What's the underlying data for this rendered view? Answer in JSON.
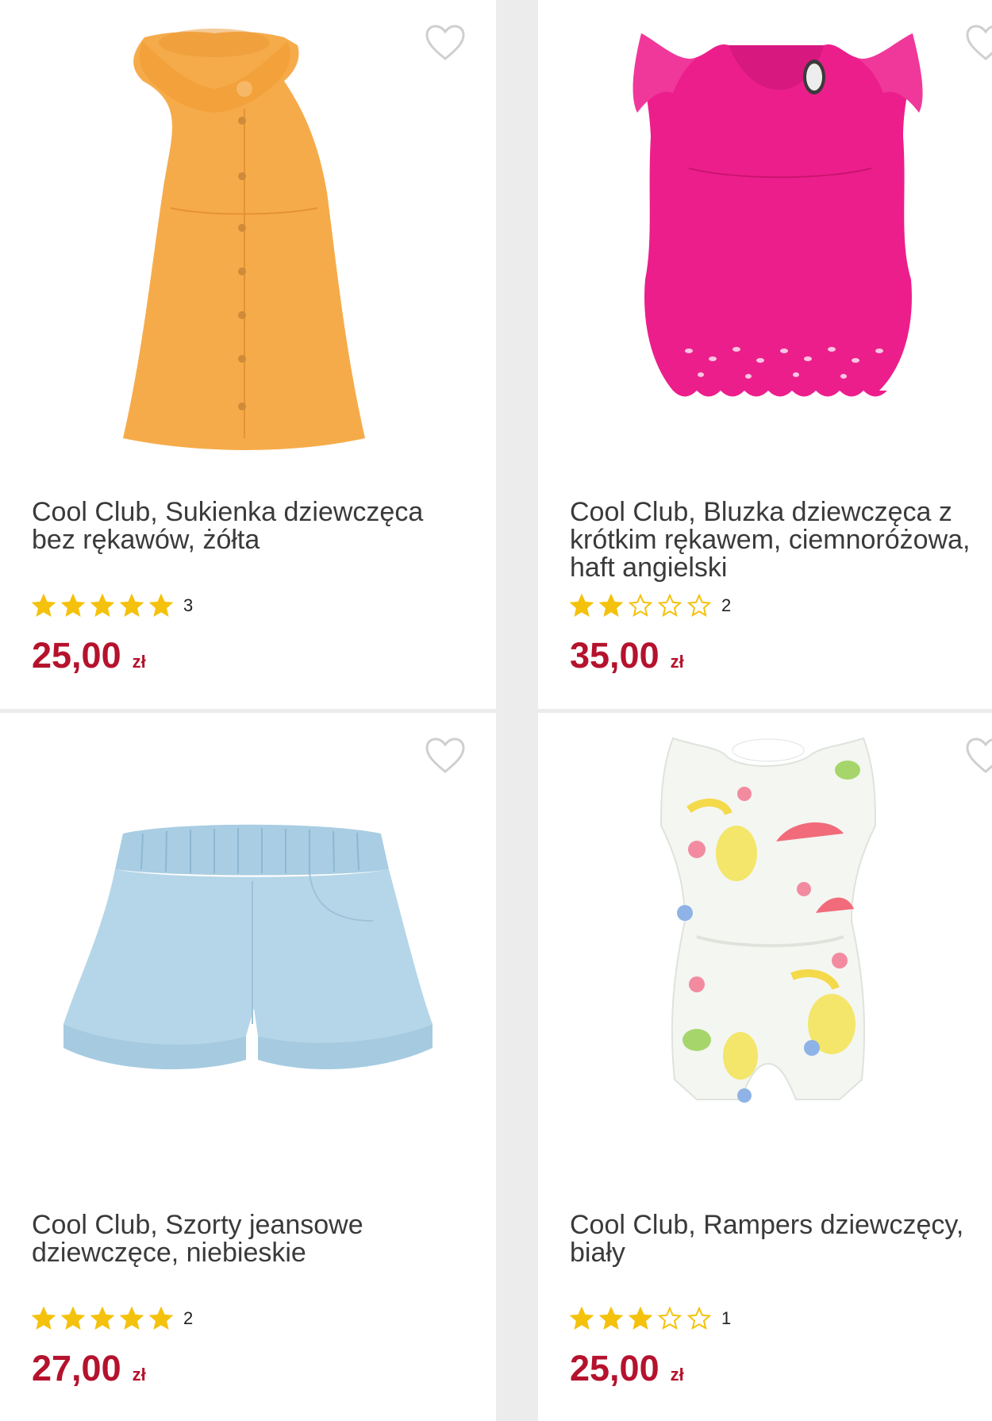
{
  "colors": {
    "price": "#b5122d",
    "star_filled": "#f4c20d",
    "star_empty": "#f4c20d",
    "heart": "#cfcfcf",
    "background": "#ececec"
  },
  "products": [
    {
      "title": "Cool Club, Sukienka dziewczęca bez rękawów, żółta",
      "rating": 5,
      "review_count": "3",
      "price": "25,00",
      "currency": "zł",
      "image_icon": "yellow-dress-image"
    },
    {
      "title": "Cool Club, Bluzka dziewczęca z krótkim rękawem, ciemnoróżowa, haft angielski",
      "rating": 2,
      "review_count": "2",
      "price": "35,00",
      "currency": "zł",
      "image_icon": "pink-blouse-image"
    },
    {
      "title": "Cool Club, Szorty jeansowe dziewczęce, niebieskie",
      "rating": 5,
      "review_count": "2",
      "price": "27,00",
      "currency": "zł",
      "image_icon": "denim-shorts-image"
    },
    {
      "title": "Cool Club, Rampers dziewczęcy, biały",
      "rating": 3,
      "review_count": "1",
      "price": "25,00",
      "currency": "zł",
      "image_icon": "fruit-romper-image"
    }
  ]
}
